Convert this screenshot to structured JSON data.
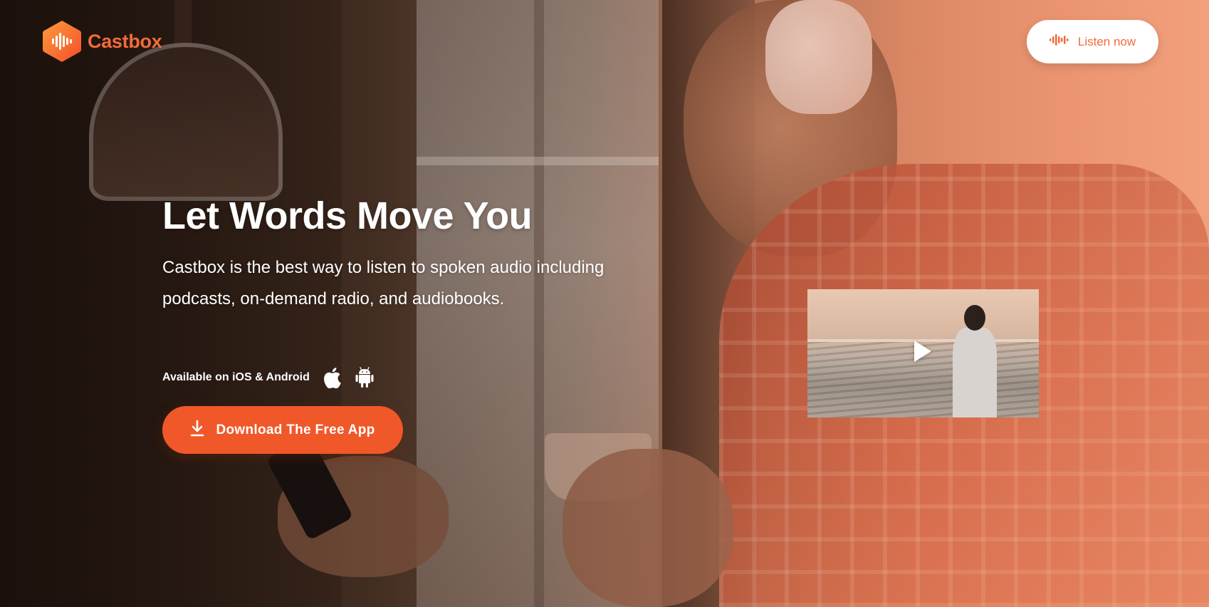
{
  "brand": {
    "name": "Castbox",
    "accent_color": "#f26b3a",
    "logo_icon": "castbox-logo-icon"
  },
  "header": {
    "listen_now_label": "Listen now",
    "listen_now_icon": "soundwave-icon"
  },
  "hero": {
    "headline": "Let Words Move You",
    "subheadline": "Castbox is the best way to listen to spoken audio including podcasts, on-demand radio, and audiobooks.",
    "availability_text": "Available on iOS & Android",
    "platform_icons": [
      "apple-icon",
      "android-icon"
    ],
    "download_label": "Download The Free App",
    "download_icon": "download-icon",
    "download_color": "#f0582a"
  },
  "video": {
    "play_icon": "play-icon"
  }
}
